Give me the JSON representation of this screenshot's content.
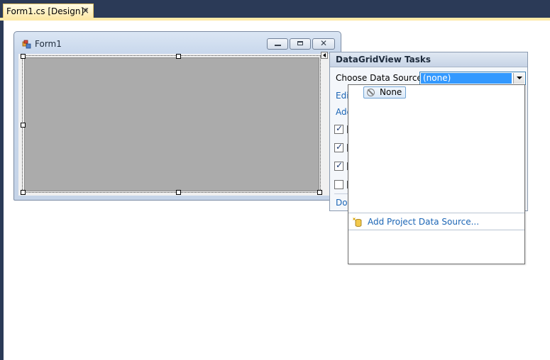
{
  "tab": {
    "title": "Form1.cs [Design]*",
    "close_glyph": "×"
  },
  "form": {
    "title": "Form1",
    "close_glyph": "✕"
  },
  "tasks_panel": {
    "title": "DataGridView Tasks",
    "data_source_label": "Choose Data Source:",
    "data_source_value": "(none)",
    "links": [
      "Edit",
      "Add",
      "Doc"
    ],
    "checkboxes": [
      {
        "checked": true
      },
      {
        "checked": true
      },
      {
        "checked": true
      },
      {
        "checked": false
      }
    ]
  },
  "dropdown": {
    "none_item": "None",
    "add_project_data_source": "Add Project Data Source..."
  },
  "colors": {
    "ide_background": "#2b3a57",
    "tab_active": "#fde9a8",
    "grid_background": "#ababab",
    "selection_blue": "#3399ff",
    "link_blue": "#1b65b5"
  },
  "icons": {
    "form": "form-icon",
    "none": "no-entry-icon",
    "add_data_source": "database-add-icon"
  }
}
